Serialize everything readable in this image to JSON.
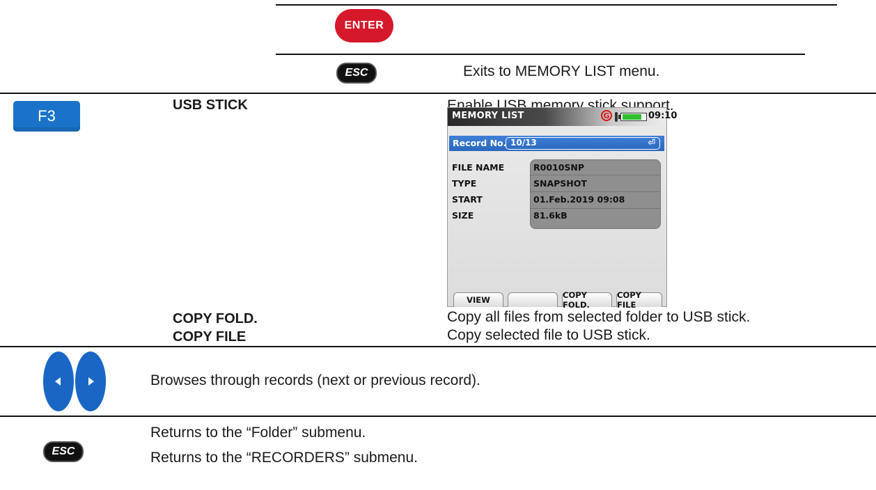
{
  "keys": {
    "enter": "ENTER",
    "esc": "ESC",
    "f3": "F3"
  },
  "rows": {
    "esc_top": "Exits to MEMORY LIST menu.",
    "usb_label": "USB STICK",
    "usb_desc": "Enable USB memory stick support.",
    "copy_fold_label": "COPY FOLD.",
    "copy_fold_desc": "Copy all files from selected folder to USB stick.",
    "copy_file_label": "COPY FILE",
    "copy_file_desc": "Copy selected file to USB stick.",
    "browse_desc": "Browses through records (next or previous record).",
    "esc_desc_1": "Returns to the “Folder” submenu.",
    "esc_desc_2": "Returns to the “RECORDERS” submenu."
  },
  "screen": {
    "title": "MEMORY LIST",
    "status_g": "G",
    "battery_level": 0.85,
    "time": "09:10",
    "record_label": "Record No.",
    "record_value": "10/13",
    "fields": [
      {
        "label": "FILE NAME",
        "value": "R0010SNP"
      },
      {
        "label": "TYPE",
        "value": "SNAPSHOT"
      },
      {
        "label": "START",
        "value": "01.Feb.2019 09:08"
      },
      {
        "label": "SIZE",
        "value": "81.6kB"
      }
    ],
    "softkeys": [
      "VIEW",
      "",
      "COPY FOLD.",
      "COPY FILE"
    ]
  },
  "colors": {
    "enter_red": "#d6182b",
    "key_blue": "#1a73c8",
    "screen_blue": "#2a67bf",
    "battery_green": "#2fbf2f"
  }
}
